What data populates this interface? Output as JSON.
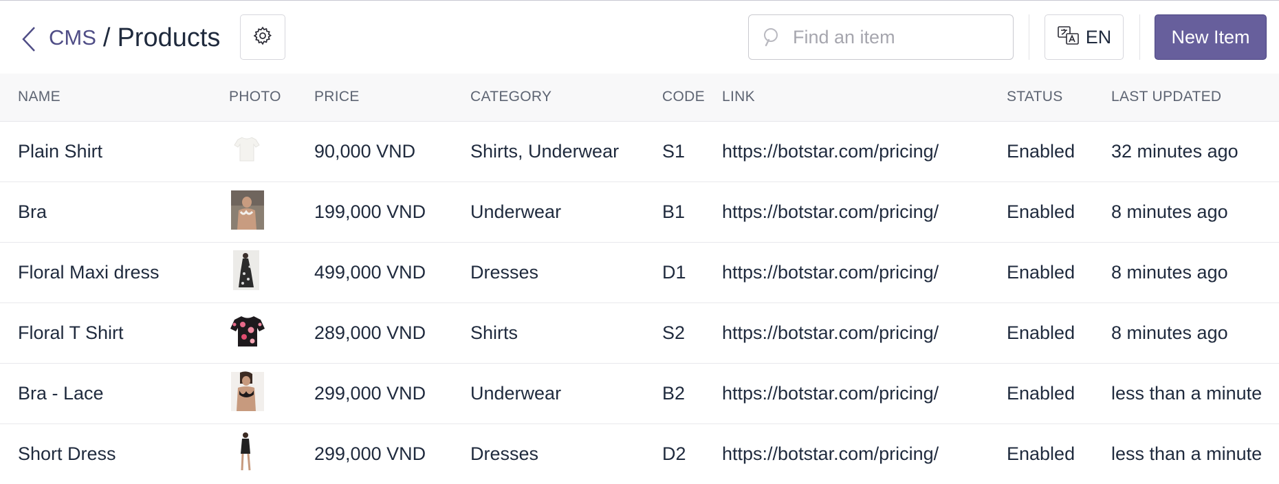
{
  "header": {
    "breadcrumb_root": "CMS",
    "breadcrumb_sep": "/",
    "page_title": "Products",
    "search_placeholder": "Find an item",
    "language": "EN",
    "new_item_label": "New Item"
  },
  "colors": {
    "accent": "#675f9c",
    "breadcrumb_link": "#4f4d86",
    "text": "#1f2a3d"
  },
  "table": {
    "columns": [
      "NAME",
      "PHOTO",
      "PRICE",
      "CATEGORY",
      "CODE",
      "LINK",
      "STATUS",
      "LAST UPDATED"
    ],
    "rows": [
      {
        "name": "Plain Shirt",
        "photo": "white-tshirt",
        "price": "90,000 VND",
        "category": "Shirts, Underwear",
        "code": "S1",
        "link": "https://botstar.com/pricing/",
        "status": "Enabled",
        "updated": "32 minutes ago"
      },
      {
        "name": "Bra",
        "photo": "bra-photo",
        "price": "199,000 VND",
        "category": "Underwear",
        "code": "B1",
        "link": "https://botstar.com/pricing/",
        "status": "Enabled",
        "updated": "8 minutes ago"
      },
      {
        "name": "Floral Maxi dress",
        "photo": "maxi-dress-photo",
        "price": "499,000 VND",
        "category": "Dresses",
        "code": "D1",
        "link": "https://botstar.com/pricing/",
        "status": "Enabled",
        "updated": "8 minutes ago"
      },
      {
        "name": "Floral T Shirt",
        "photo": "floral-tshirt",
        "price": "289,000 VND",
        "category": "Shirts",
        "code": "S2",
        "link": "https://botstar.com/pricing/",
        "status": "Enabled",
        "updated": "8 minutes ago"
      },
      {
        "name": "Bra - Lace",
        "photo": "lace-bra-photo",
        "price": "299,000 VND",
        "category": "Underwear",
        "code": "B2",
        "link": "https://botstar.com/pricing/",
        "status": "Enabled",
        "updated": "less than a minute"
      },
      {
        "name": "Short Dress",
        "photo": "short-dress-photo",
        "price": "299,000 VND",
        "category": "Dresses",
        "code": "D2",
        "link": "https://botstar.com/pricing/",
        "status": "Enabled",
        "updated": "less than a minute"
      }
    ]
  },
  "icons": {
    "back": "chevron-left-icon",
    "settings": "gear-icon",
    "search": "search-icon",
    "language": "translate-icon"
  }
}
